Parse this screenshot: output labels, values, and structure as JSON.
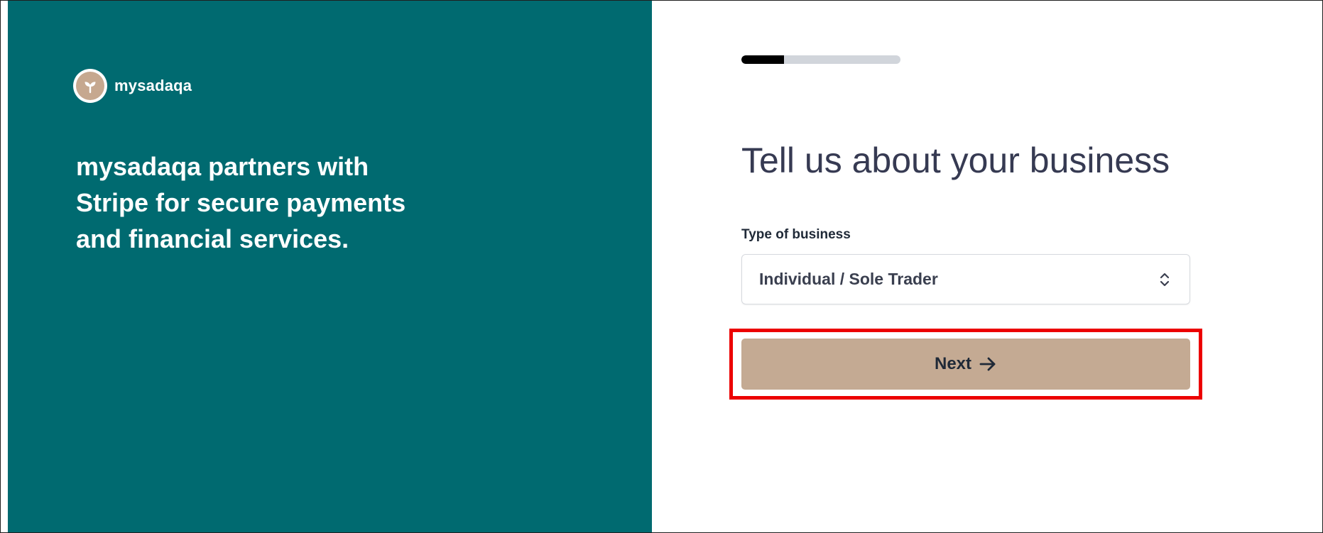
{
  "brand": {
    "name": "mysadaqa",
    "logo_icon": "leaf-icon",
    "logo_color": "#c6a88f"
  },
  "tagline": "mysadaqa partners with Stripe for secure payments and financial services.",
  "progress": {
    "fraction": 0.27
  },
  "form": {
    "heading": "Tell us about your business",
    "business_type_label": "Type of business",
    "business_type_value": "Individual / Sole Trader",
    "select_icon": "chevron-up-down-icon",
    "next_label": "Next",
    "next_icon": "arrow-right-icon"
  },
  "colors": {
    "left_panel": "#006a70",
    "button": "#c4aa93",
    "heading": "#363a52",
    "highlight": "#ec0000"
  }
}
